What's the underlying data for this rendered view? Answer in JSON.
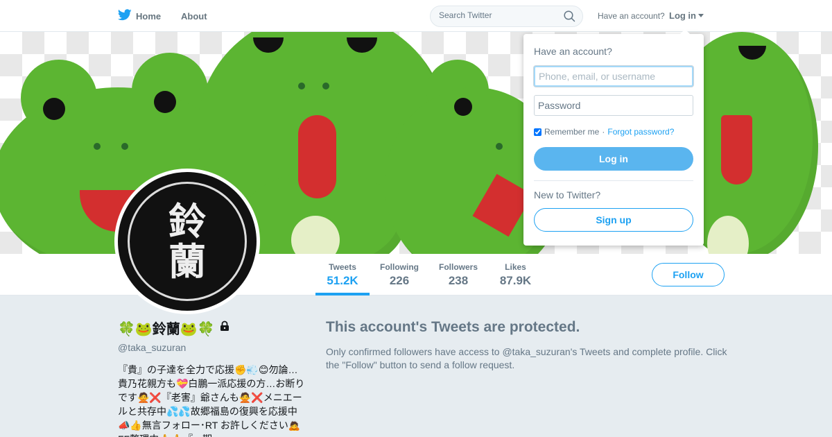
{
  "nav": {
    "home_label": "Home",
    "about_label": "About",
    "search_placeholder": "Search Twitter",
    "have_account": "Have an account?",
    "login_label": "Log in",
    "brand_color": "#1da1f2"
  },
  "profile": {
    "display_name": "🍀🐸鈴蘭🐸🍀",
    "handle": "@taka_suzuran",
    "bio": "『貴』の子達を全力で応援✊💨😊勿論…貴乃花親方も💝白鵬一派応援の方…お断りです🙅❌『老害』爺さんも🙅❌メニエールと共存中💦💦故郷福島の復興を応援中📣👍無言フォロー･RT お許しください🙇FF整理中🙏🙏『…期",
    "avatar_text": "鈴\n蘭",
    "follow_label": "Follow"
  },
  "stats": [
    {
      "label": "Tweets",
      "value": "51.2K"
    },
    {
      "label": "Following",
      "value": "226"
    },
    {
      "label": "Followers",
      "value": "238"
    },
    {
      "label": "Likes",
      "value": "87.9K"
    }
  ],
  "protected": {
    "title": "This account's Tweets are protected.",
    "body": "Only confirmed followers have access to @taka_suzuran's Tweets and complete profile. Click the \"Follow\" button to send a follow request."
  },
  "login_dropdown": {
    "heading": "Have an account?",
    "username_placeholder": "Phone, email, or username",
    "password_placeholder": "Password",
    "remember_label": "Remember me",
    "separator": "·",
    "forgot_label": "Forgot password?",
    "login_button": "Log in",
    "new_to_twitter": "New to Twitter?",
    "signup_button": "Sign up"
  }
}
